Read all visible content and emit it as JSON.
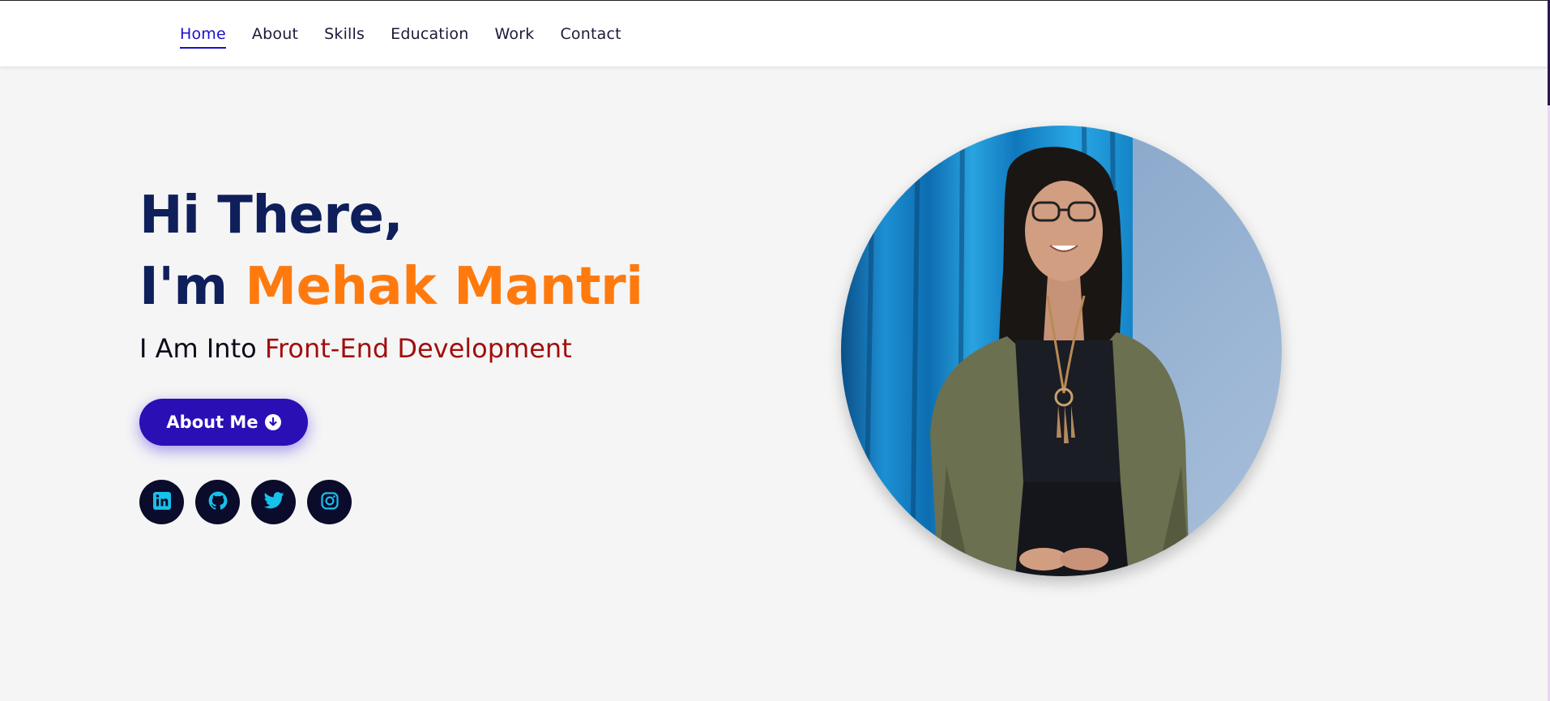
{
  "nav": {
    "items": [
      {
        "label": "Home",
        "active": true
      },
      {
        "label": "About",
        "active": false
      },
      {
        "label": "Skills",
        "active": false
      },
      {
        "label": "Education",
        "active": false
      },
      {
        "label": "Work",
        "active": false
      },
      {
        "label": "Contact",
        "active": false
      }
    ]
  },
  "hero": {
    "greeting": "Hi There,",
    "im_prefix": "I'm ",
    "name": "Mehak Mantri",
    "into_prefix": "I Am Into ",
    "role": "Front-End Development",
    "button_label": "About Me",
    "button_icon": "arrow-circle-down-icon"
  },
  "socials": [
    {
      "name": "linkedin-icon"
    },
    {
      "name": "github-icon"
    },
    {
      "name": "twitter-icon"
    },
    {
      "name": "instagram-icon"
    }
  ],
  "colors": {
    "nav_active": "#1a0fd0",
    "heading": "#0e1f5b",
    "name": "#ff7a0e",
    "role": "#a10e0e",
    "button": "#2a0fb5",
    "social_bg": "#0b0b2b",
    "social_icon": "#16c1ea",
    "background": "#f5f5f5"
  }
}
